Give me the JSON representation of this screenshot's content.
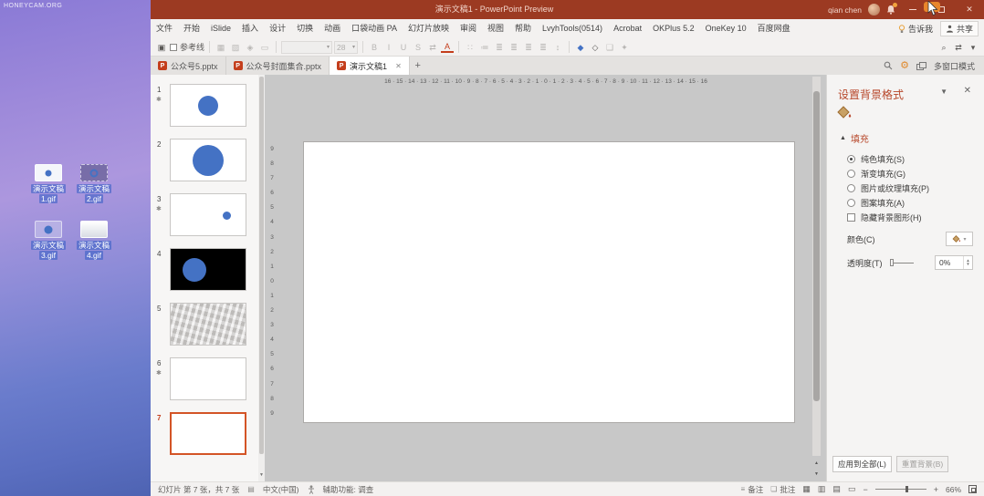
{
  "colors": {
    "accent": "#B7472A",
    "selection": "#D35426",
    "shape_blue": "#4472C4",
    "titlebar": "#9C3A22"
  },
  "desktop": {
    "watermark": "HONEYCAM.ORG",
    "icons": [
      {
        "line1": "演示文稿",
        "line2": "1.gif",
        "thumb": "dot-doc"
      },
      {
        "line1": "演示文稿",
        "line2": "2.gif",
        "thumb": "ring-doc"
      },
      {
        "line1": "演示文稿",
        "line2": "3.gif",
        "thumb": "circle-doc"
      },
      {
        "line1": "演示文稿",
        "line2": "4.gif",
        "thumb": "blank-doc"
      }
    ]
  },
  "titlebar": {
    "title": "演示文稿1 - PowerPoint Preview",
    "user": "qian chen"
  },
  "menu": {
    "tabs": [
      "文件",
      "开始",
      "iSlide",
      "插入",
      "设计",
      "切换",
      "动画",
      "口袋动画 PA",
      "幻灯片放映",
      "审阅",
      "视图",
      "帮助",
      "LvyhTools(0514)",
      "Acrobat",
      "OKPlus 5.2",
      "OneKey 10",
      "百度网盘"
    ],
    "tell_me": "告诉我",
    "share": "共享"
  },
  "toolbar": {
    "items": [
      {
        "k": "icon",
        "name": "paste-icon",
        "glyph": "▣"
      },
      {
        "k": "check",
        "name": "guides-checkbox",
        "label": "参考线"
      },
      {
        "k": "sep"
      },
      {
        "k": "icon",
        "name": "table-icon",
        "glyph": "▦",
        "disabled": true
      },
      {
        "k": "icon",
        "name": "picture-icon",
        "glyph": "▨",
        "disabled": true
      },
      {
        "k": "icon",
        "name": "shapes-icon",
        "glyph": "◈",
        "disabled": true
      },
      {
        "k": "icon",
        "name": "text-box-icon",
        "glyph": "▭",
        "disabled": true
      },
      {
        "k": "sep"
      },
      {
        "k": "select",
        "name": "font-family-select",
        "text": "",
        "w": 56,
        "disabled": true
      },
      {
        "k": "select",
        "name": "font-size-select",
        "text": "28",
        "w": 26,
        "disabled": true
      },
      {
        "k": "sep"
      },
      {
        "k": "icon",
        "name": "bold-icon",
        "glyph": "B",
        "disabled": true
      },
      {
        "k": "icon",
        "name": "italic-icon",
        "glyph": "I",
        "disabled": true
      },
      {
        "k": "icon",
        "name": "underline-icon",
        "glyph": "U",
        "disabled": true
      },
      {
        "k": "icon",
        "name": "text-shadow-icon",
        "glyph": "S",
        "disabled": true
      },
      {
        "k": "icon",
        "name": "char-spacing-icon",
        "glyph": "⇄",
        "disabled": true
      },
      {
        "k": "icon",
        "name": "font-color-icon",
        "glyph": "A",
        "accent": true
      },
      {
        "k": "sep"
      },
      {
        "k": "icon",
        "name": "bullets-icon",
        "glyph": "∷",
        "disabled": true
      },
      {
        "k": "icon",
        "name": "numbering-icon",
        "glyph": "≔",
        "disabled": true
      },
      {
        "k": "icon",
        "name": "align-left-icon",
        "glyph": "≣",
        "disabled": true
      },
      {
        "k": "icon",
        "name": "align-center-icon",
        "glyph": "≣",
        "disabled": true
      },
      {
        "k": "icon",
        "name": "align-right-icon",
        "glyph": "≣",
        "disabled": true
      },
      {
        "k": "icon",
        "name": "justify-icon",
        "glyph": "≣",
        "disabled": true
      },
      {
        "k": "icon",
        "name": "line-spacing-icon",
        "glyph": "↕",
        "disabled": true
      },
      {
        "k": "sep"
      },
      {
        "k": "icon",
        "name": "shape-fill-icon",
        "glyph": "◆",
        "blue": true
      },
      {
        "k": "icon",
        "name": "shape-outline-icon",
        "glyph": "◇"
      },
      {
        "k": "icon",
        "name": "arrange-icon",
        "glyph": "❑",
        "disabled": true
      },
      {
        "k": "icon",
        "name": "quick-styles-icon",
        "glyph": "✦",
        "disabled": true
      },
      {
        "k": "spring"
      },
      {
        "k": "icon",
        "name": "find-icon",
        "glyph": "⌕"
      },
      {
        "k": "icon",
        "name": "replace-icon",
        "glyph": "⇄"
      },
      {
        "k": "icon",
        "name": "more-tools-icon",
        "glyph": "▾"
      }
    ]
  },
  "tabs": {
    "items": [
      {
        "label": "公众号5.pptx"
      },
      {
        "label": "公众号封面集合.pptx"
      },
      {
        "label": "演示文稿1",
        "active": true,
        "closable": true
      }
    ],
    "new_label": "+",
    "multi_window": "多窗口模式"
  },
  "slides": {
    "items": [
      {
        "num": "1",
        "star": true,
        "thumb": "circle-md"
      },
      {
        "num": "2",
        "star": false,
        "thumb": "circle-lg"
      },
      {
        "num": "3",
        "star": true,
        "thumb": "dot-right"
      },
      {
        "num": "4",
        "star": false,
        "thumb": "black-circle"
      },
      {
        "num": "5",
        "star": false,
        "thumb": "texture"
      },
      {
        "num": "6",
        "star": true,
        "thumb": "blank"
      },
      {
        "num": "7",
        "star": false,
        "thumb": "blank",
        "selected": true
      }
    ]
  },
  "ruler": {
    "horizontal": "16 · 15 · 14 · 13 · 12 · 11 · 10 · 9 · 8 · 7 · 6 · 5 · 4 · 3 · 2 · 1 · 0 · 1 · 2 · 3 · 4 · 5 · 6 · 7 · 8 · 9 · 10 · 11 · 12 · 13 · 14 · 15 · 16",
    "vertical": "9\n8\n7\n6\n5\n4\n3\n2\n1\n0\n1\n2\n3\n4\n5\n6\n7\n8\n9"
  },
  "panel": {
    "title": "设置背景格式",
    "fill_section": "填充",
    "options": [
      {
        "type": "radio",
        "label": "纯色填充(S)",
        "checked": true
      },
      {
        "type": "radio",
        "label": "渐变填充(G)",
        "checked": false
      },
      {
        "type": "radio",
        "label": "图片或纹理填充(P)",
        "checked": false
      },
      {
        "type": "radio",
        "label": "图案填充(A)",
        "checked": false
      },
      {
        "type": "checkbox",
        "label": "隐藏背景图形(H)",
        "checked": false
      }
    ],
    "color_label": "颜色(C)",
    "transparency_label": "透明度(T)",
    "transparency_value": "0%",
    "apply_all": "应用到全部(L)",
    "reset": "重置背景(B)"
  },
  "statusbar": {
    "slide_info": "幻灯片 第 7 张，共 7 张",
    "language": "中文(中国)",
    "accessibility": "辅助功能: 调查",
    "notes": "备注",
    "comments": "批注",
    "zoom": "66%"
  }
}
